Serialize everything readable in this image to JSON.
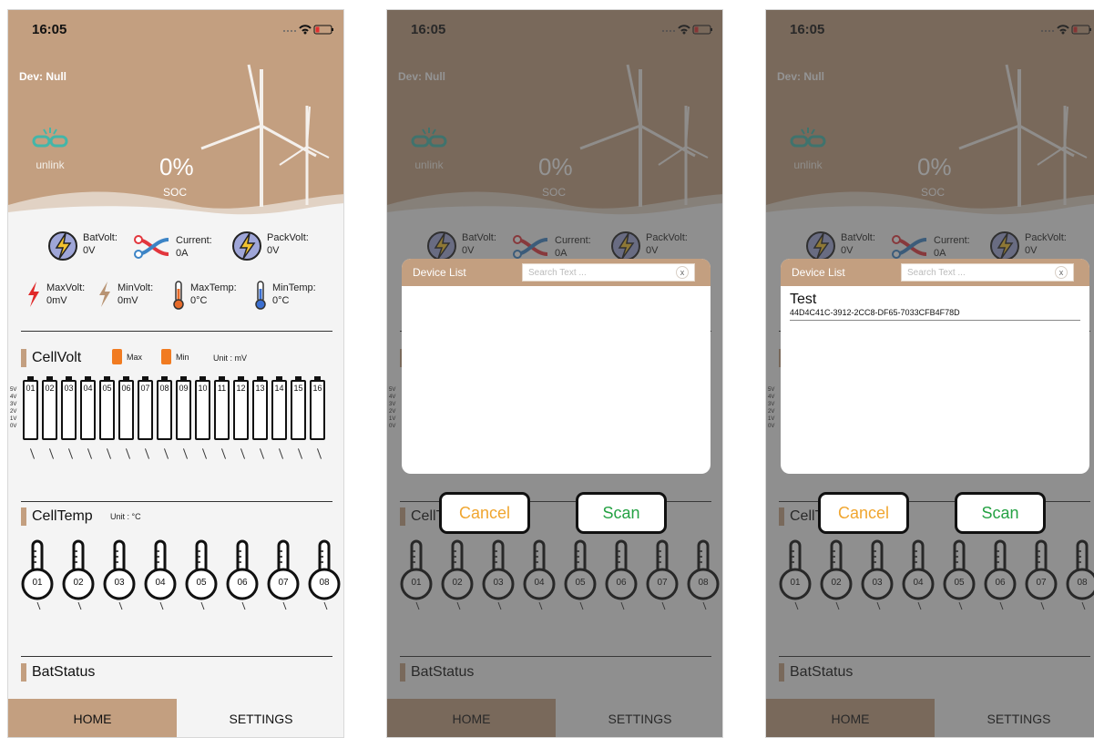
{
  "screens": [
    {
      "id": "home",
      "dialog": false
    },
    {
      "id": "device-list-empty",
      "dialog": true
    },
    {
      "id": "device-list-found",
      "dialog": true
    }
  ],
  "status": {
    "time": "16:05"
  },
  "header": {
    "device": "Dev: Null",
    "link_label": "unlink",
    "soc_value": "0%",
    "soc_label": "SOC"
  },
  "metrics": {
    "batvolt_label": "BatVolt:",
    "batvolt_value": "0V",
    "current_label": "Current:",
    "current_value": "0A",
    "packvolt_label": "PackVolt:",
    "packvolt_value": "0V",
    "maxvolt_label": "MaxVolt:",
    "maxvolt_value": "0mV",
    "minvolt_label": "MinVolt:",
    "minvolt_value": "0mV",
    "maxtemp_label": "MaxTemp:",
    "maxtemp_value": "0°C",
    "mintemp_label": "MinTemp:",
    "mintemp_value": "0°C"
  },
  "cellvolt": {
    "title": "CellVolt",
    "legend_max": "Max",
    "legend_min": "Min",
    "unit": "Unit : mV",
    "scale": [
      "5V",
      "4V",
      "3V",
      "2V",
      "1V",
      "0V"
    ],
    "cells": [
      "01",
      "02",
      "03",
      "04",
      "05",
      "06",
      "07",
      "08",
      "09",
      "10",
      "11",
      "12",
      "13",
      "14",
      "15",
      "16"
    ]
  },
  "celltemp": {
    "title": "CellTemp",
    "unit": "Unit : °C",
    "sensors": [
      "01",
      "02",
      "03",
      "04",
      "05",
      "06",
      "07",
      "08"
    ]
  },
  "batstatus": {
    "title": "BatStatus"
  },
  "tabs": {
    "home": "HOME",
    "settings": "SETTINGS"
  },
  "dialog": {
    "title": "Device List",
    "search_placeholder": "Search Text ...",
    "close": "x",
    "cancel": "Cancel",
    "scan": "Scan",
    "device_name": "Test",
    "device_uuid": "44D4C41C-3912-2CC8-DF65-7033CFB4F78D"
  },
  "colors": {
    "brand": "#c39f80",
    "cancel": "#f0a630",
    "scan": "#25a244",
    "max_battery": "#f17b21"
  }
}
